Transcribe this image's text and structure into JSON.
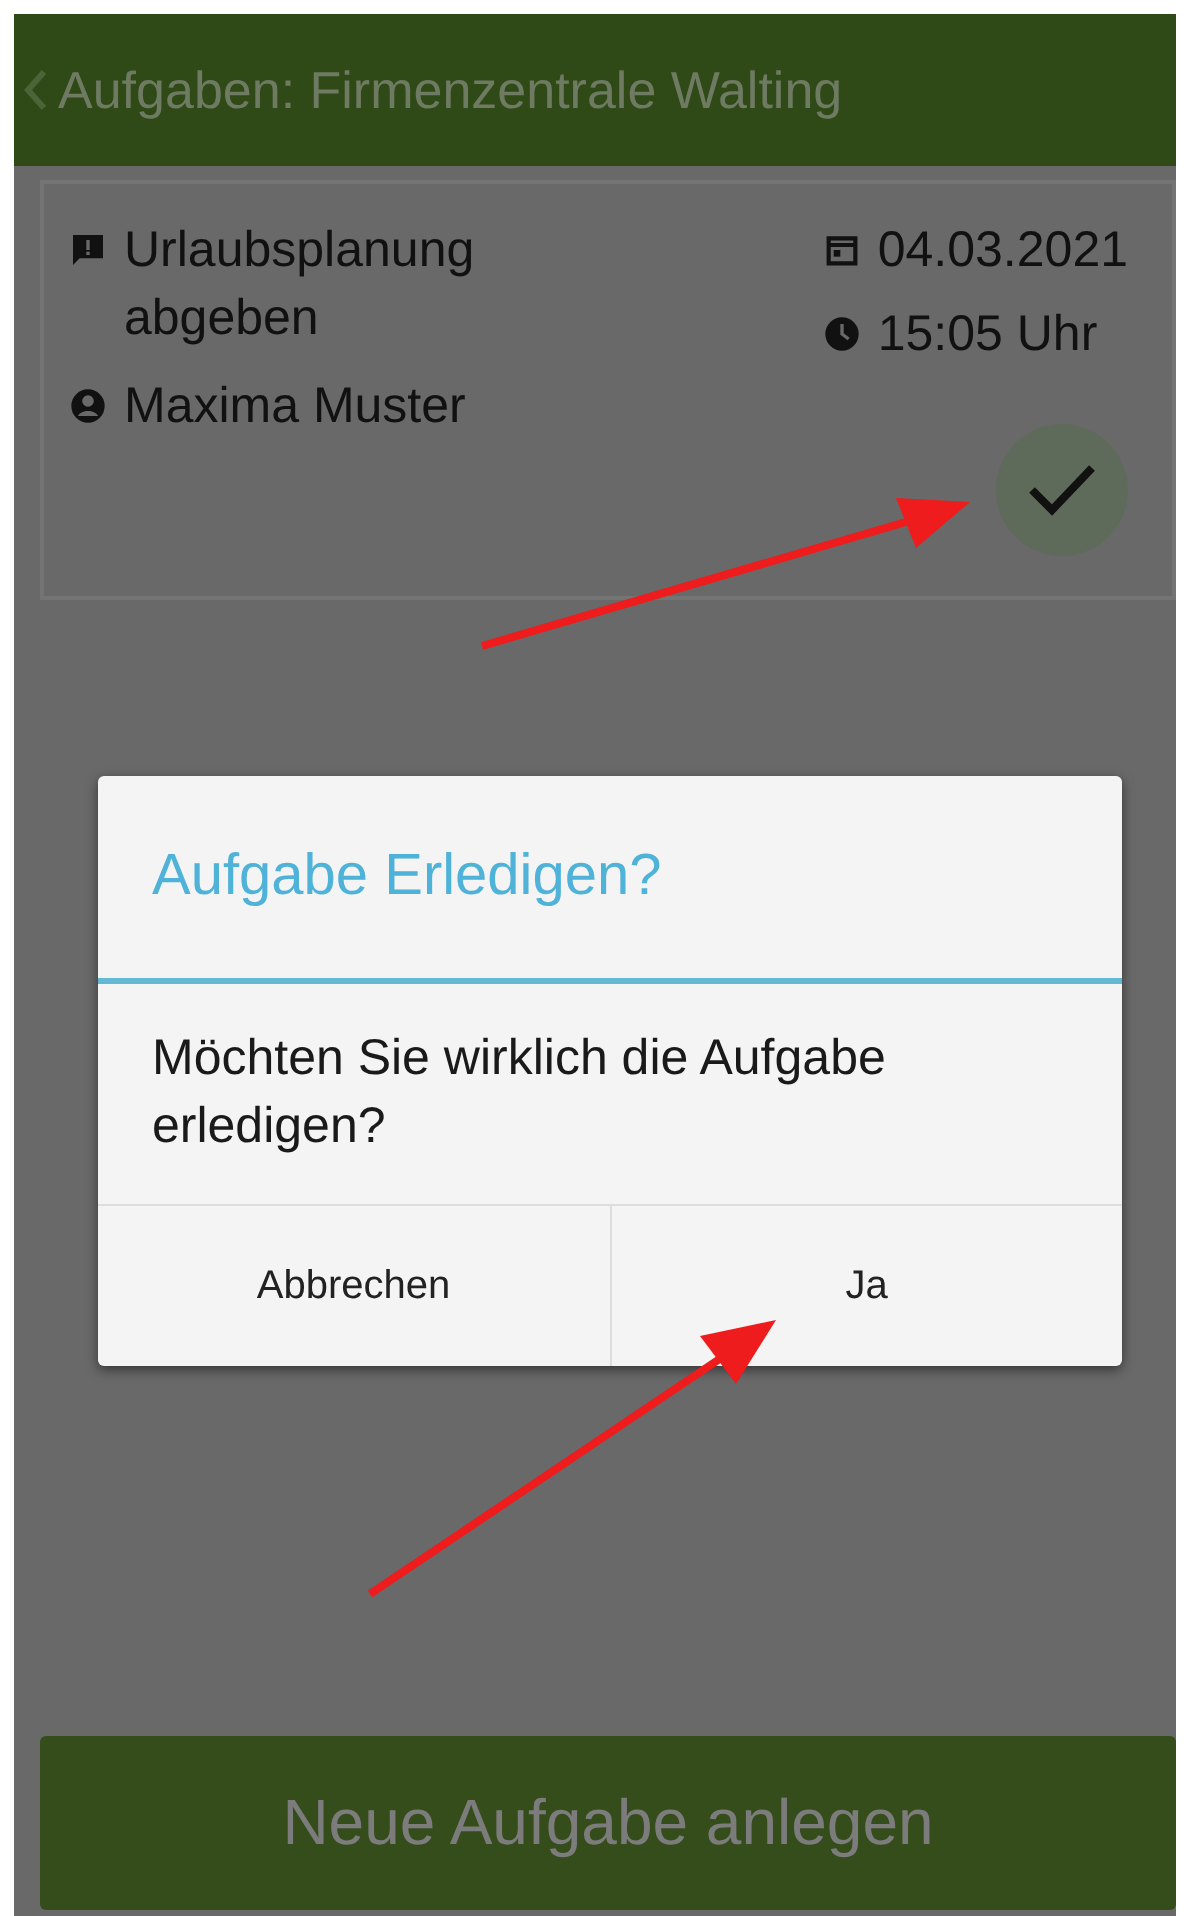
{
  "header": {
    "title": "Aufgaben: Firmenzentrale Walting"
  },
  "task": {
    "title": "Urlaubsplanung abgeben",
    "assignee": "Maxima Muster",
    "date": "04.03.2021",
    "time": "15:05 Uhr"
  },
  "dialog": {
    "title": "Aufgabe Erledigen?",
    "message": "Möchten Sie wirklich die Aufgabe erledigen?",
    "buttons": [
      {
        "label": "Abbrechen"
      },
      {
        "label": "Ja"
      }
    ]
  },
  "primary_button": {
    "label": "Neue Aufgabe anlegen"
  }
}
